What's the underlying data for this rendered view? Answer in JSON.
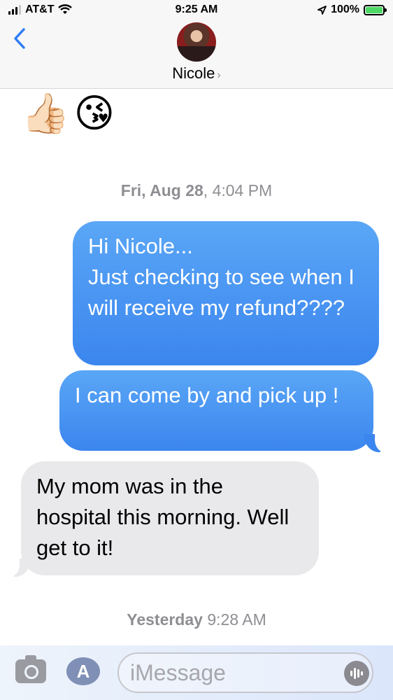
{
  "status_bar": {
    "carrier": "AT&T",
    "time": "9:25 AM",
    "battery": "100%"
  },
  "header": {
    "contact_name": "Nicole",
    "chevron": "›",
    "back_icon": "chevron-left-icon"
  },
  "messages": {
    "emoji_reactions": [
      "👍🏻",
      "😘"
    ],
    "timestamp1": {
      "day": "Fri, Aug 28",
      "time": "4:04 PM"
    },
    "sent_1": "Hi Nicole...\nJust checking to see when I will receive my refund????",
    "sent_2": "I can come by and pick up !",
    "received_1": "My mom was in the hospital this morning. Well get to it!",
    "timestamp2": {
      "day": "Yesterday",
      "time": "9:28 AM"
    }
  },
  "compose": {
    "placeholder": "iMessage",
    "camera_icon": "camera-icon",
    "apps_icon": "app-store-icon",
    "audio_icon": "audio-waveform-icon"
  },
  "colors": {
    "sent_bubble": "#3b86ee",
    "received_bubble": "#e9e9eb",
    "accent": "#2f7df6"
  }
}
